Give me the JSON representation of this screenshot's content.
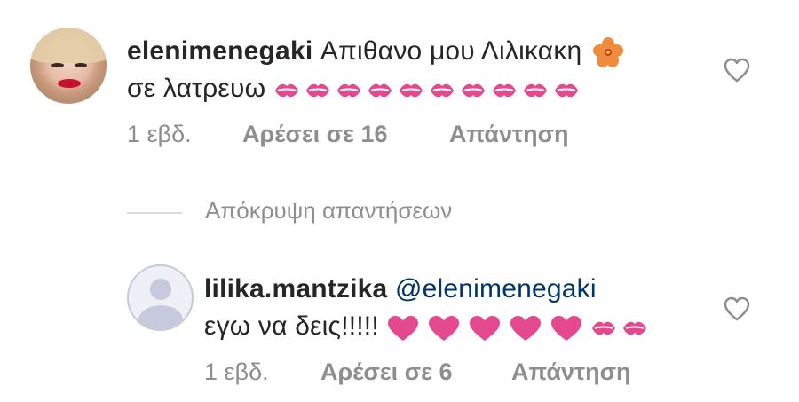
{
  "comments": [
    {
      "username": "elenimenegaki",
      "text_line1": "Απιθανο μου Λιλικακη",
      "text_line2": "σε λατρευω",
      "emoji_line1": "hibiscus",
      "emoji_line2": [
        "kiss",
        "kiss",
        "kiss",
        "kiss",
        "kiss",
        "kiss",
        "kiss",
        "kiss",
        "kiss",
        "kiss"
      ],
      "time": "1 εβδ.",
      "likes": "Αρέσει σε 16",
      "reply": "Απάντηση",
      "like_icon": "heart-outline-icon"
    },
    {
      "username": "lilika.mantzika",
      "mention": "@elenimenegaki",
      "text_line2": "εγω να δεις!!!!!",
      "emoji_line2": [
        "heart",
        "heart",
        "heart",
        "heart",
        "heart",
        "kiss",
        "kiss"
      ],
      "time": "1 εβδ.",
      "likes": "Αρέσει σε 6",
      "reply": "Απάντηση",
      "like_icon": "heart-outline-icon"
    }
  ],
  "hide_replies": "Απόκρυψη απαντήσεων",
  "colors": {
    "text": "#262626",
    "meta": "#8e8e8e",
    "mention": "#003569",
    "emoji_pink": "#e4488f"
  }
}
